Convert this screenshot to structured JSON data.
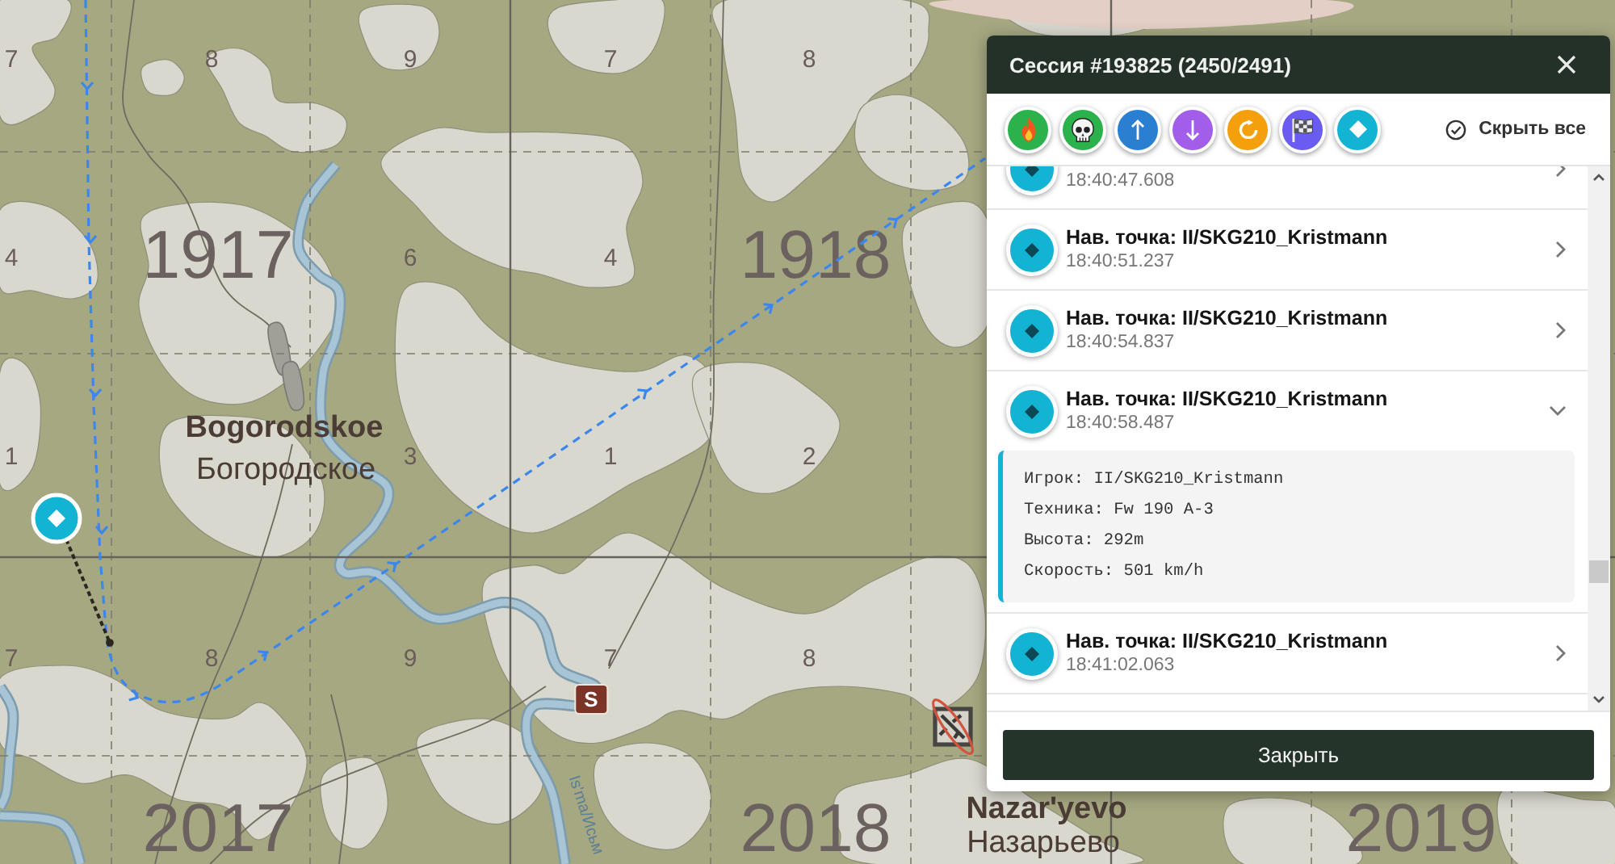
{
  "map": {
    "squares": [
      {
        "label": "1917"
      },
      {
        "label": "1918"
      },
      {
        "label": "2017"
      },
      {
        "label": "2018"
      },
      {
        "label": "2019"
      }
    ],
    "keypad_numbers": [
      "7",
      "8",
      "9",
      "7",
      "8",
      "4",
      "6",
      "4",
      "1",
      "3",
      "1",
      "2",
      "7",
      "8",
      "9",
      "7",
      "8"
    ],
    "towns": [
      {
        "name": "Bogorodskoe",
        "local_name": "Богородское"
      },
      {
        "name": "Nazar'yevo",
        "local_name": "Назарьево"
      }
    ],
    "river_label": "Is'ma/Исьм",
    "markers": [
      {
        "kind": "letter",
        "label": "S"
      },
      {
        "kind": "crossed_plane"
      },
      {
        "kind": "waypoint"
      }
    ]
  },
  "panel": {
    "title": "Сессия #193825 (2450/2491)",
    "filters": [
      {
        "kind": "fire",
        "color": "#2bb24c"
      },
      {
        "kind": "skull",
        "color": "#2bb24c"
      },
      {
        "kind": "up",
        "color": "#2a7fd0"
      },
      {
        "kind": "down",
        "color": "#a25ee8"
      },
      {
        "kind": "loop",
        "color": "#f4a00c"
      },
      {
        "kind": "flag",
        "color": "#6a5cf0"
      },
      {
        "kind": "waypoint",
        "color": "#13b3d3"
      }
    ],
    "hide_all": "Скрыть все",
    "events": [
      {
        "kind": "waypoint",
        "time": "18:40:47.608",
        "expanded": false
      },
      {
        "kind": "waypoint",
        "title": "Нав. точка: II/SKG210_Kristmann",
        "time": "18:40:51.237",
        "expanded": false
      },
      {
        "kind": "waypoint",
        "title": "Нав. точка: II/SKG210_Kristmann",
        "time": "18:40:54.837",
        "expanded": false
      },
      {
        "kind": "waypoint",
        "title": "Нав. точка: II/SKG210_Kristmann",
        "time": "18:40:58.487",
        "expanded": true,
        "details": [
          "Игрок: II/SKG210_Kristmann",
          "Техника: Fw 190 A-3",
          "Высота: 292m",
          "Скорость: 501 km/h"
        ]
      },
      {
        "kind": "waypoint",
        "title": "Нав. точка: II/SKG210_Kristmann",
        "time": "18:41:02.063",
        "expanded": false
      }
    ],
    "close_button": "Закрыть"
  }
}
